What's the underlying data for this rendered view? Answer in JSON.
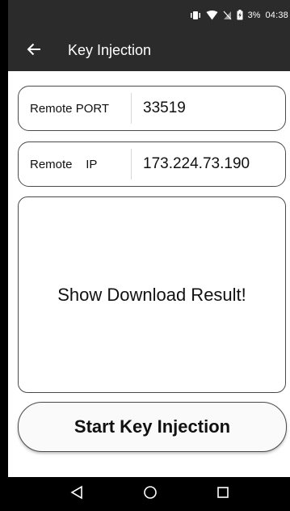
{
  "status_bar": {
    "battery_percent": "3%",
    "time": "04:38",
    "icons": [
      "vibrate-icon",
      "wifi-icon",
      "no-sim-icon",
      "battery-charging-icon"
    ]
  },
  "app_bar": {
    "title": "Key Injection",
    "back_icon": "arrow-left-icon"
  },
  "form": {
    "port": {
      "label": "Remote PORT",
      "value": "33519"
    },
    "ip": {
      "label": "Remote    IP",
      "value": "173.224.73.190"
    }
  },
  "result": {
    "text": "Show Download Result!"
  },
  "actions": {
    "start_label": "Start Key Injection"
  },
  "nav_bar": {
    "icons": [
      "nav-back-icon",
      "nav-home-icon",
      "nav-recents-icon"
    ]
  },
  "colors": {
    "app_bar_bg": "#2b2b2b",
    "background": "#ffffff",
    "border": "#4a4a4a"
  }
}
